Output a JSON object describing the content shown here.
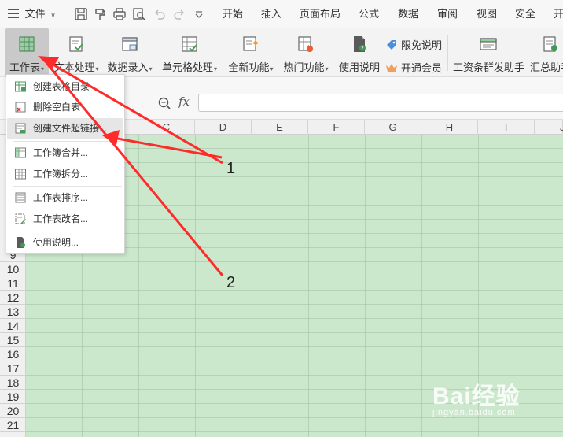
{
  "menubar": {
    "file_label": "文件",
    "tabs": [
      "开始",
      "插入",
      "页面布局",
      "公式",
      "数据",
      "审阅",
      "视图",
      "安全",
      "开"
    ]
  },
  "ribbon": {
    "buttons": [
      {
        "label": "工作表",
        "icon": "worksheet-icon"
      },
      {
        "label": "文本处理",
        "icon": "text-process-icon"
      },
      {
        "label": "数据录入",
        "icon": "data-entry-icon"
      },
      {
        "label": "单元格处理",
        "icon": "cell-process-icon"
      },
      {
        "label": "全新功能",
        "icon": "new-feature-icon"
      },
      {
        "label": "热门功能",
        "icon": "hot-feature-icon"
      },
      {
        "label": "使用说明",
        "icon": "manual-icon"
      },
      {
        "label": "工资条群发助手",
        "icon": "payroll-icon"
      },
      {
        "label": "汇总助手",
        "icon": "summary-icon"
      }
    ],
    "limited_free_label": "限免说明",
    "membership_label": "开通会员"
  },
  "formula_bar": {
    "fx_label": "fx",
    "value": ""
  },
  "grid": {
    "columns": [
      "C",
      "D",
      "E",
      "F",
      "G",
      "H",
      "I",
      "J"
    ],
    "rows": [
      "9",
      "10",
      "11",
      "12",
      "13",
      "14",
      "15",
      "16",
      "17",
      "18",
      "19",
      "20",
      "21"
    ]
  },
  "dropdown": {
    "items": [
      {
        "label": "创建表格目录",
        "icon": "table-directory-icon"
      },
      {
        "label": "删除空白表",
        "icon": "delete-blank-sheet-icon"
      },
      {
        "label": "创建文件超链接...",
        "icon": "hyperlink-icon"
      },
      {
        "label": "工作簿合并...",
        "icon": "workbook-merge-icon"
      },
      {
        "label": "工作簿拆分...",
        "icon": "workbook-split-icon"
      },
      {
        "label": "工作表排序...",
        "icon": "sheet-sort-icon"
      },
      {
        "label": "工作表改名...",
        "icon": "sheet-rename-icon"
      },
      {
        "label": "使用说明...",
        "icon": "help-doc-icon"
      }
    ]
  },
  "annotations": {
    "label_1": "1",
    "label_2": "2",
    "arrow_color": "#ff2a2a"
  },
  "watermark": {
    "brand": "Bai经验",
    "url": "jingyan.baidu.com"
  },
  "colors": {
    "grid_fill": "#cbe8cd",
    "accent_green": "#3f9a54"
  }
}
